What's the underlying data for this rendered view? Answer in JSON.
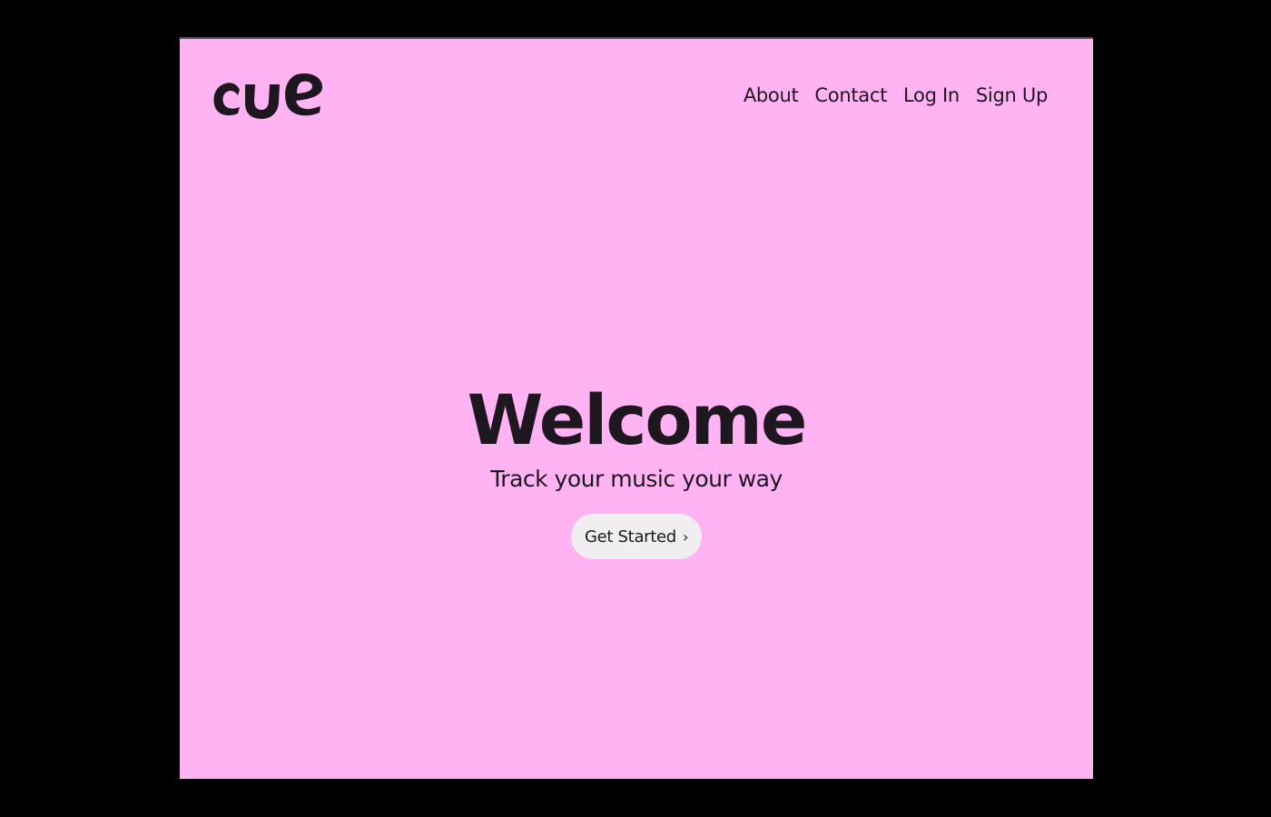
{
  "brand": {
    "logo_text": "cue",
    "background_color": "#ffb3f3",
    "text_color": "#1e1720"
  },
  "nav": {
    "items": [
      {
        "label": "About"
      },
      {
        "label": "Contact"
      },
      {
        "label": "Log In"
      },
      {
        "label": "Sign Up"
      }
    ]
  },
  "hero": {
    "title": "Welcome",
    "subtitle": "Track your music your way",
    "cta_label": "Get Started",
    "cta_icon": "chevron-right-icon"
  }
}
